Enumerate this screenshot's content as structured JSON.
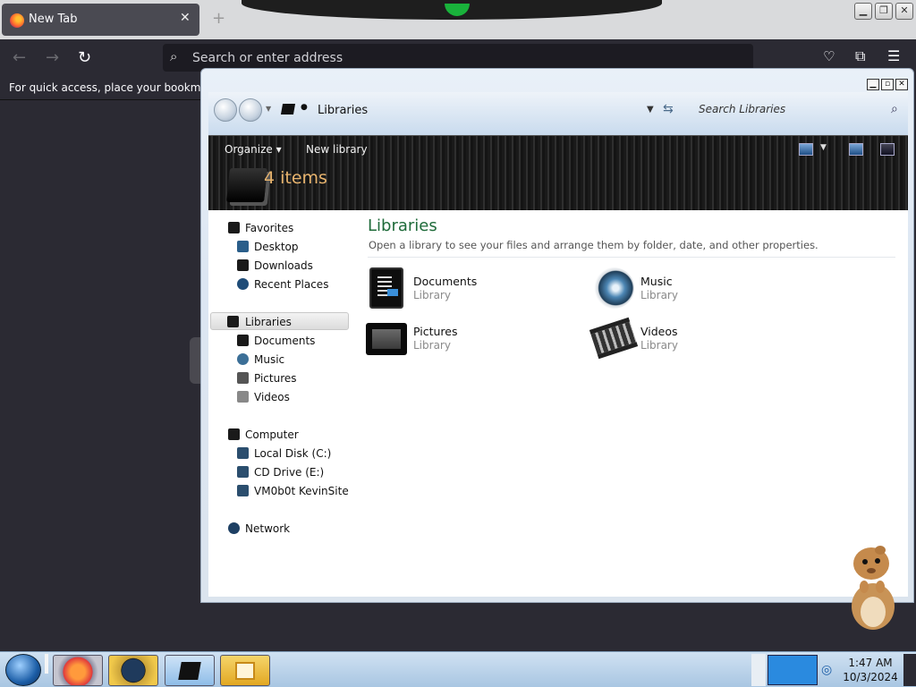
{
  "browser": {
    "tab": {
      "title": "New Tab",
      "close_icon": "close-icon",
      "favicon": "firefox-icon"
    },
    "new_tab_icon": "+",
    "window_controls": {
      "minimize": "▁",
      "restore": "❐",
      "close": "✕"
    },
    "nav": {
      "back": "←",
      "forward": "→",
      "reload": "↻"
    },
    "urlbar": {
      "placeholder": "Search or enter address",
      "icon": "search-icon"
    },
    "toolbar_icons": [
      "pocket-icon",
      "extensions-icon",
      "menu-icon"
    ],
    "bookmarks_hint": "For quick access, place your bookmarks h"
  },
  "explorer": {
    "title_buttons": {
      "minimize": "▁",
      "restore": "▫",
      "close": "✕"
    },
    "address": {
      "crumb": "Libraries",
      "search_placeholder": "Search Libraries"
    },
    "command_bar": {
      "organize": "Organize ▾",
      "new_library": "New library",
      "item_count": "4 items"
    },
    "nav_pane": {
      "favorites": {
        "header": "Favorites",
        "items": [
          "Desktop",
          "Downloads",
          "Recent Places"
        ]
      },
      "libraries": {
        "header": "Libraries",
        "items": [
          "Documents",
          "Music",
          "Pictures",
          "Videos"
        ]
      },
      "computer": {
        "header": "Computer",
        "items": [
          "Local Disk (C:)",
          "CD Drive (E:)",
          "VM0b0t KevinSite"
        ]
      },
      "network": {
        "header": "Network"
      }
    },
    "content": {
      "heading": "Libraries",
      "description": "Open a library to see your files and arrange them by folder, date, and other properties.",
      "libraries": [
        {
          "name": "Documents",
          "type": "Library",
          "icon": "documents-icon"
        },
        {
          "name": "Music",
          "type": "Library",
          "icon": "music-speaker-icon"
        },
        {
          "name": "Pictures",
          "type": "Library",
          "icon": "pictures-icon"
        },
        {
          "name": "Videos",
          "type": "Library",
          "icon": "videos-filmstrip-icon"
        }
      ]
    }
  },
  "taskbar": {
    "clock": {
      "time": "1:47 AM",
      "date": "10/3/2024"
    },
    "buttons": [
      "firefox-icon",
      "globe-icon",
      "libraries-icon",
      "media-player-icon"
    ],
    "accent": "#a9c6e2"
  }
}
